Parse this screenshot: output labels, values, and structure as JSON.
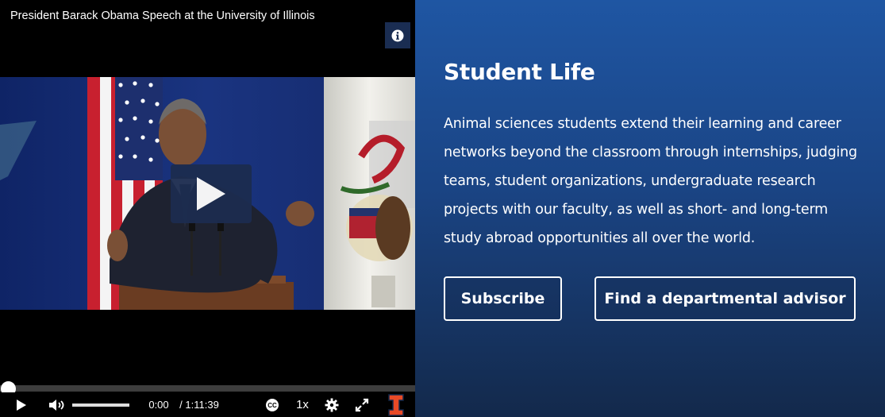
{
  "video": {
    "title": "President Barack Obama Speech at the University of Illinois",
    "info_icon": "info-icon",
    "play_icon": "play-icon",
    "progress": 0.0,
    "volume": 1.0,
    "current_time": "0:00",
    "duration": "/ 1:11:39",
    "cc_label": "CC",
    "speed": "1x",
    "brand_logo": "illinois-block-i-logo"
  },
  "panel": {
    "heading": "Student Life",
    "body": "Animal sciences students extend their learning and career networks beyond the classroom through internships, judging teams, student organizations, undergraduate research projects with our faculty, as well as short- and long-term study abroad opportunities all over the world.",
    "buttons": [
      {
        "label": "Subscribe"
      },
      {
        "label": "Find a departmental advisor"
      }
    ]
  },
  "colors": {
    "panel_top": "#1f56a3",
    "panel_bottom": "#13294b",
    "illinois_orange": "#e84a27",
    "player_button": "#1c2c4f"
  }
}
